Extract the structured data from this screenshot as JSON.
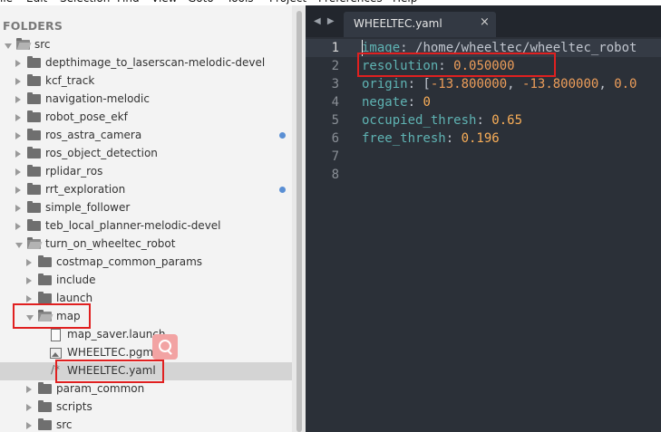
{
  "menubar": [
    "ile",
    "Edit",
    "Selection",
    "Find",
    "View",
    "Goto",
    "Tools",
    "Project",
    "Preferences",
    "Help"
  ],
  "sidebar": {
    "title": "FOLDERS",
    "tree": [
      {
        "label": "src",
        "kind": "folder-open",
        "depth": 0,
        "expanded": true
      },
      {
        "label": "depthimage_to_laserscan-melodic-devel",
        "kind": "folder",
        "depth": 1
      },
      {
        "label": "kcf_track",
        "kind": "folder",
        "depth": 1
      },
      {
        "label": "navigation-melodic",
        "kind": "folder",
        "depth": 1
      },
      {
        "label": "robot_pose_ekf",
        "kind": "folder",
        "depth": 1
      },
      {
        "label": "ros_astra_camera",
        "kind": "folder",
        "depth": 1,
        "dot": true
      },
      {
        "label": "ros_object_detection",
        "kind": "folder",
        "depth": 1
      },
      {
        "label": "rplidar_ros",
        "kind": "folder",
        "depth": 1
      },
      {
        "label": "rrt_exploration",
        "kind": "folder",
        "depth": 1,
        "dot": true
      },
      {
        "label": "simple_follower",
        "kind": "folder",
        "depth": 1
      },
      {
        "label": "teb_local_planner-melodic-devel",
        "kind": "folder",
        "depth": 1
      },
      {
        "label": "turn_on_wheeltec_robot",
        "kind": "folder-open",
        "depth": 1,
        "expanded": true
      },
      {
        "label": "costmap_common_params",
        "kind": "folder",
        "depth": 2
      },
      {
        "label": "include",
        "kind": "folder",
        "depth": 2
      },
      {
        "label": "launch",
        "kind": "folder",
        "depth": 2
      },
      {
        "label": "map",
        "kind": "folder-open",
        "depth": 2,
        "expanded": true
      },
      {
        "label": "map_saver.launch",
        "kind": "file",
        "depth": 3
      },
      {
        "label": "WHEELTEC.pgm",
        "kind": "image",
        "depth": 3
      },
      {
        "label": "WHEELTEC.yaml",
        "kind": "yaml",
        "depth": 3,
        "selected": true
      },
      {
        "label": "param_common",
        "kind": "folder",
        "depth": 2
      },
      {
        "label": "scripts",
        "kind": "folder",
        "depth": 2
      },
      {
        "label": "src",
        "kind": "folder",
        "depth": 2
      }
    ]
  },
  "tabbar": {
    "nav_arrows": "◀ ▶",
    "active_tab": "WHEELTEC.yaml",
    "close_glyph": "×"
  },
  "editor": {
    "line_numbers": [
      "1",
      "2",
      "3",
      "4",
      "5",
      "6",
      "7",
      "8"
    ],
    "lines": [
      [
        {
          "t": "image",
          "c": "k"
        },
        {
          "t": ": ",
          "c": "p"
        },
        {
          "t": "/home/wheeltec/wheeltec_robot",
          "c": "p"
        }
      ],
      [
        {
          "t": "resolution",
          "c": "k"
        },
        {
          "t": ": ",
          "c": "p"
        },
        {
          "t": "0.050000",
          "c": "v"
        }
      ],
      [
        {
          "t": "origin",
          "c": "k"
        },
        {
          "t": ": [",
          "c": "p"
        },
        {
          "t": "-13.800000",
          "c": "v"
        },
        {
          "t": ", ",
          "c": "p"
        },
        {
          "t": "-13.800000",
          "c": "v"
        },
        {
          "t": ", ",
          "c": "p"
        },
        {
          "t": "0.0",
          "c": "v"
        }
      ],
      [
        {
          "t": "negate",
          "c": "k"
        },
        {
          "t": ": ",
          "c": "p"
        },
        {
          "t": "0",
          "c": "n"
        }
      ],
      [
        {
          "t": "occupied_thresh",
          "c": "k"
        },
        {
          "t": ": ",
          "c": "p"
        },
        {
          "t": "0.65",
          "c": "n"
        }
      ],
      [
        {
          "t": "free_thresh",
          "c": "k"
        },
        {
          "t": ": ",
          "c": "p"
        },
        {
          "t": "0.196",
          "c": "n"
        }
      ],
      [],
      []
    ]
  },
  "colors": {
    "annotation": "#e02020",
    "modified_dot": "#5a8fd4",
    "yaml_key": "#5fb3b3",
    "yaml_value": "#ec9d5a"
  }
}
